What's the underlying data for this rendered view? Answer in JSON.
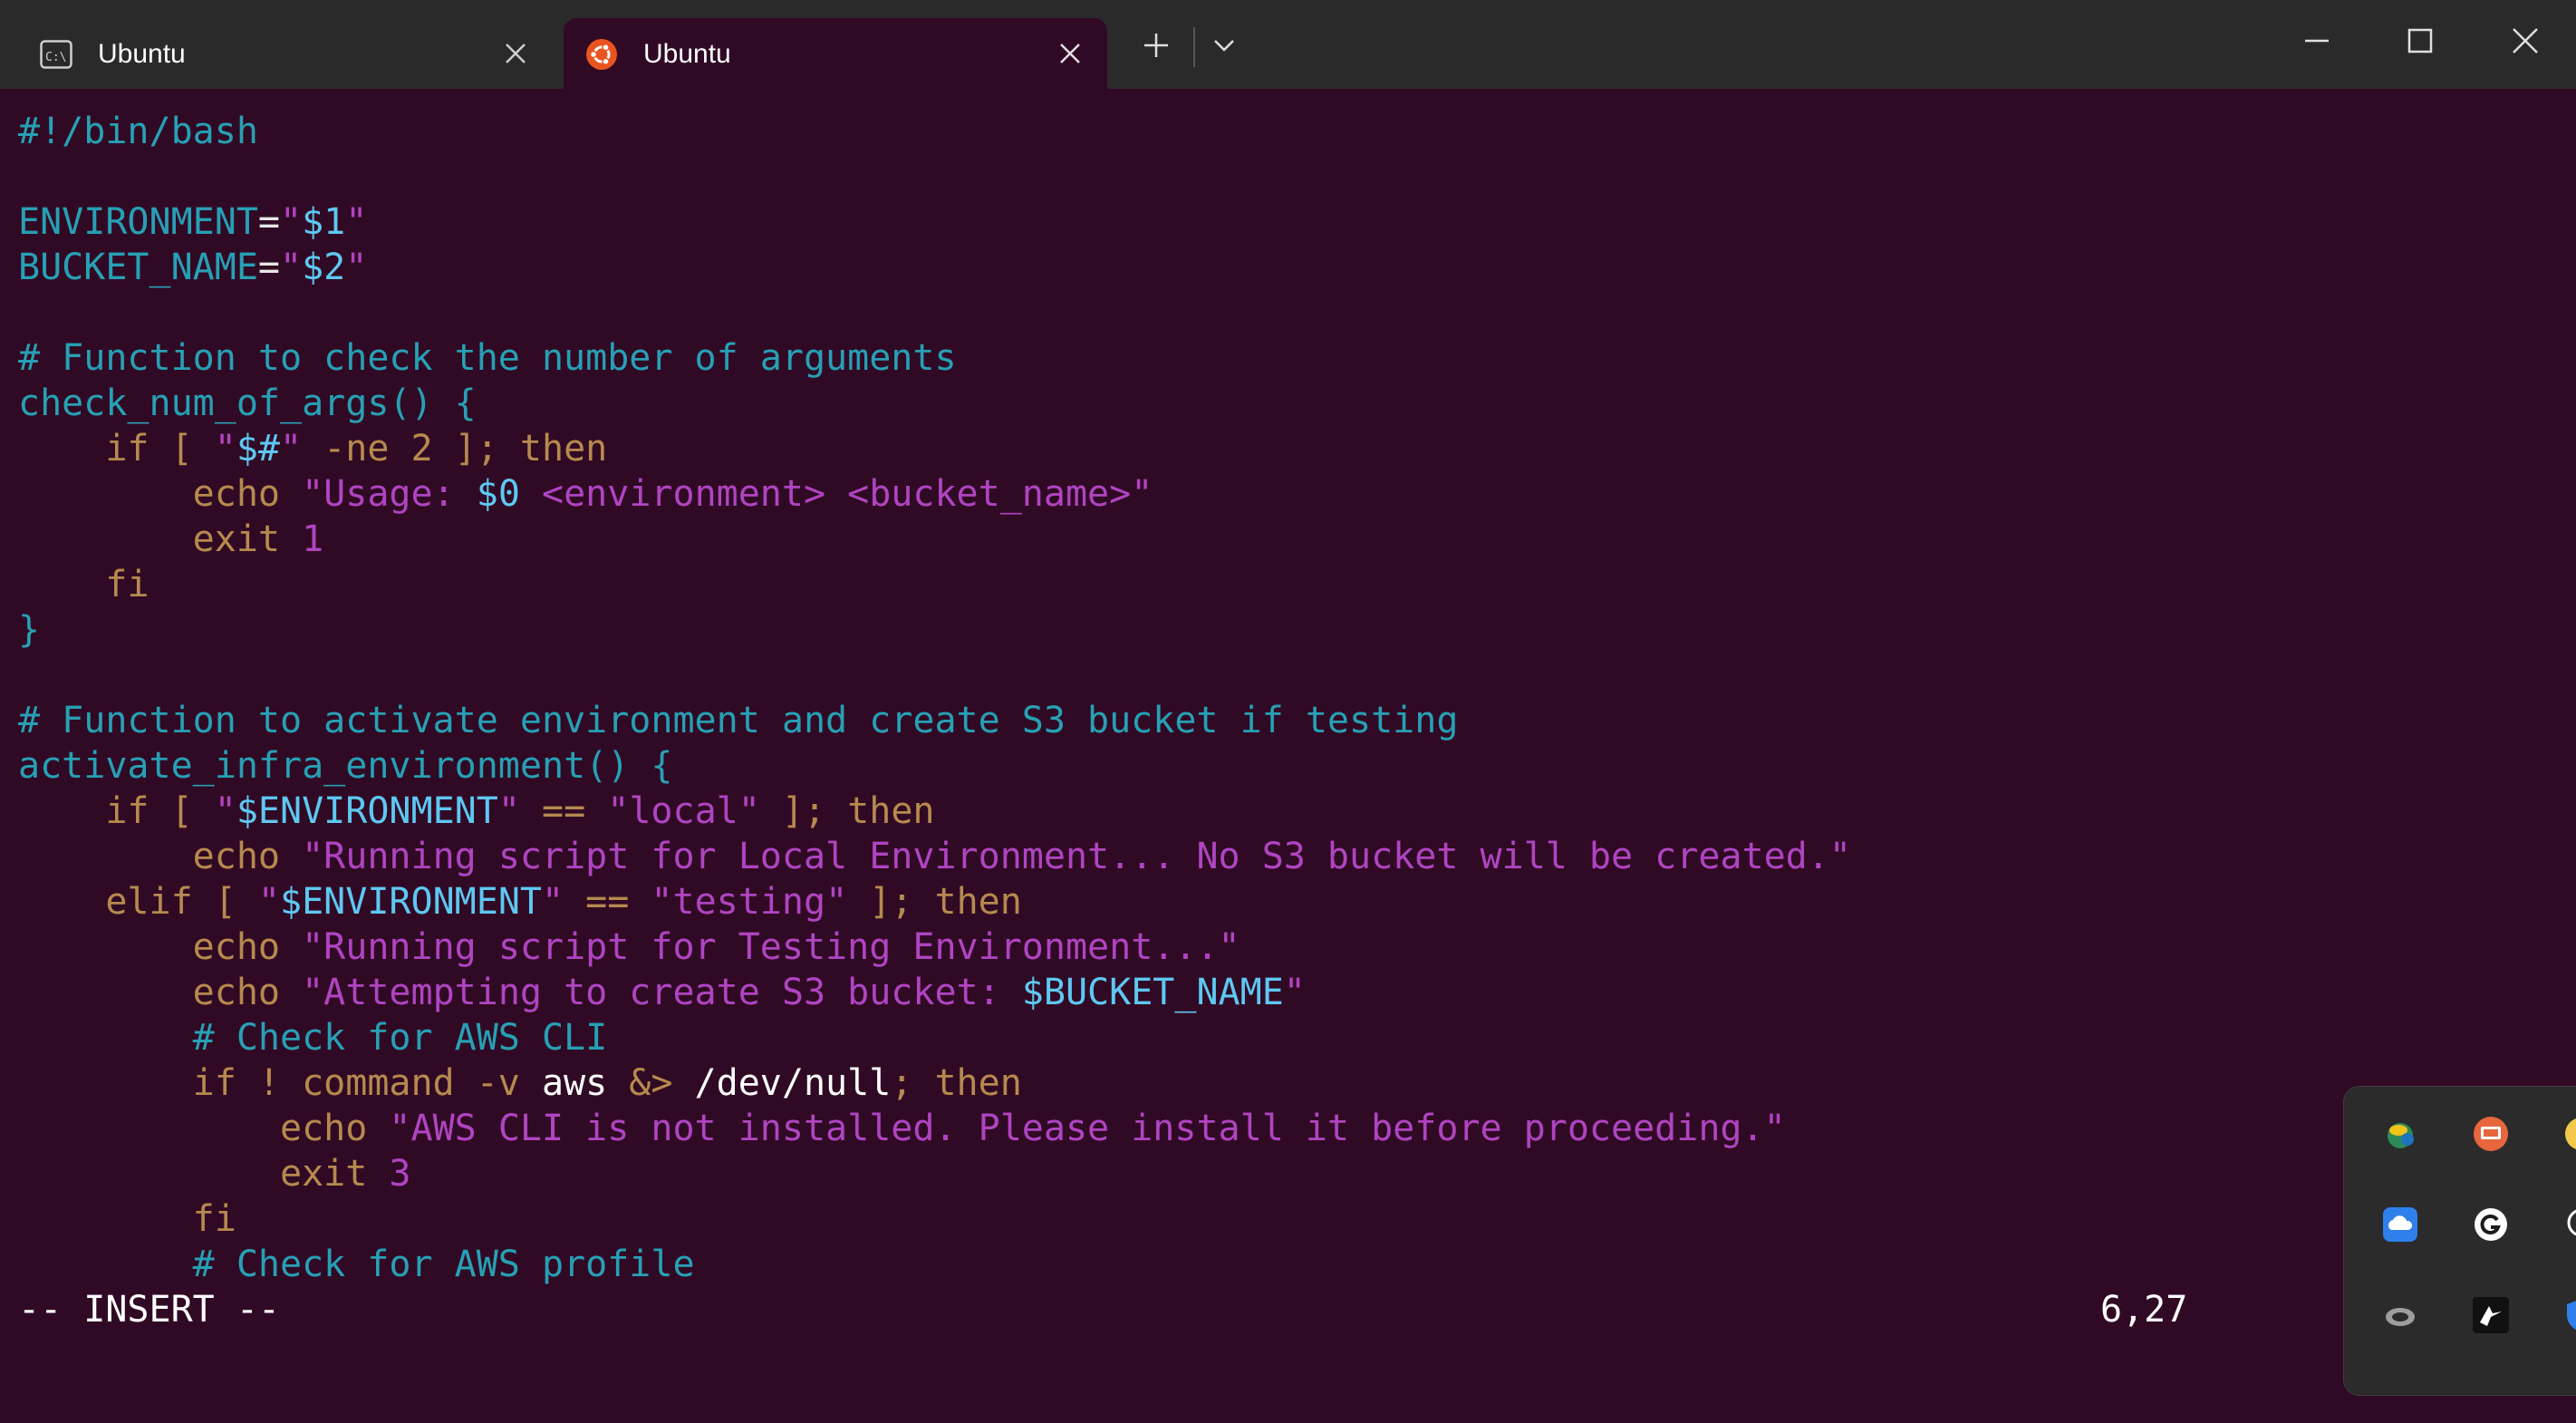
{
  "tabs": [
    {
      "label": "Ubuntu",
      "icon": "cmd-icon",
      "active": false
    },
    {
      "label": "Ubuntu",
      "icon": "ubuntu-icon",
      "active": true
    }
  ],
  "toolbar": {
    "new_tab_icon": "plus-icon",
    "dropdown_icon": "chevron-down-icon"
  },
  "window_controls": [
    "minimize-icon",
    "maximize-icon",
    "close-icon"
  ],
  "code_lines": [
    [
      {
        "t": "#!/bin/bash",
        "c": "cm"
      }
    ],
    [],
    [
      {
        "t": "ENVIRONMENT",
        "c": "id"
      },
      {
        "t": "=",
        "c": "pl"
      },
      {
        "t": "\"",
        "c": "st"
      },
      {
        "t": "$1",
        "c": "va"
      },
      {
        "t": "\"",
        "c": "st"
      }
    ],
    [
      {
        "t": "BUCKET_NAME",
        "c": "id"
      },
      {
        "t": "=",
        "c": "pl"
      },
      {
        "t": "\"",
        "c": "st"
      },
      {
        "t": "$2",
        "c": "va"
      },
      {
        "t": "\"",
        "c": "st"
      }
    ],
    [],
    [
      {
        "t": "# Function to check the number of arguments",
        "c": "cm"
      }
    ],
    [
      {
        "t": "check_num_of_args() {",
        "c": "id"
      }
    ],
    [
      {
        "t": "    if [ ",
        "c": "kw"
      },
      {
        "t": "\"",
        "c": "st"
      },
      {
        "t": "$#",
        "c": "va"
      },
      {
        "t": "\"",
        "c": "st"
      },
      {
        "t": " -ne 2 ]; then",
        "c": "kw"
      }
    ],
    [
      {
        "t": "        echo ",
        "c": "kw"
      },
      {
        "t": "\"Usage: ",
        "c": "st"
      },
      {
        "t": "$0",
        "c": "va"
      },
      {
        "t": " <environment> <bucket_name>\"",
        "c": "st"
      }
    ],
    [
      {
        "t": "        exit ",
        "c": "kw"
      },
      {
        "t": "1",
        "c": "st"
      }
    ],
    [
      {
        "t": "    fi",
        "c": "kw"
      }
    ],
    [
      {
        "t": "}",
        "c": "id"
      }
    ],
    [],
    [
      {
        "t": "# Function to activate environment and create S3 bucket if testing",
        "c": "cm"
      }
    ],
    [
      {
        "t": "activate_infra_environment() {",
        "c": "id"
      }
    ],
    [
      {
        "t": "    if [ ",
        "c": "kw"
      },
      {
        "t": "\"",
        "c": "st"
      },
      {
        "t": "$ENVIRONMENT",
        "c": "va"
      },
      {
        "t": "\"",
        "c": "st"
      },
      {
        "t": " == ",
        "c": "kw"
      },
      {
        "t": "\"local\"",
        "c": "st"
      },
      {
        "t": " ]; then",
        "c": "kw"
      }
    ],
    [
      {
        "t": "        echo ",
        "c": "kw"
      },
      {
        "t": "\"Running script for Local Environment... No S3 bucket will be created.\"",
        "c": "st"
      }
    ],
    [
      {
        "t": "    elif [ ",
        "c": "kw"
      },
      {
        "t": "\"",
        "c": "st"
      },
      {
        "t": "$ENVIRONMENT",
        "c": "va"
      },
      {
        "t": "\"",
        "c": "st"
      },
      {
        "t": " == ",
        "c": "kw"
      },
      {
        "t": "\"testing\"",
        "c": "st"
      },
      {
        "t": " ]; then",
        "c": "kw"
      }
    ],
    [
      {
        "t": "        echo ",
        "c": "kw"
      },
      {
        "t": "\"Running script for Testing Environment...\"",
        "c": "st"
      }
    ],
    [
      {
        "t": "        echo ",
        "c": "kw"
      },
      {
        "t": "\"Attempting to create S3 bucket: ",
        "c": "st"
      },
      {
        "t": "$BUCKET_NAME",
        "c": "va"
      },
      {
        "t": "\"",
        "c": "st"
      }
    ],
    [
      {
        "t": "        # Check for AWS CLI",
        "c": "cm"
      }
    ],
    [
      {
        "t": "        if ! command -v ",
        "c": "kw"
      },
      {
        "t": "aws",
        "c": "wh"
      },
      {
        "t": " &> ",
        "c": "kw"
      },
      {
        "t": "/dev/null",
        "c": "wh"
      },
      {
        "t": "; then",
        "c": "kw"
      }
    ],
    [
      {
        "t": "            echo ",
        "c": "kw"
      },
      {
        "t": "\"AWS CLI is not installed. Please install it before proceeding.\"",
        "c": "st"
      }
    ],
    [
      {
        "t": "            exit ",
        "c": "kw"
      },
      {
        "t": "3",
        "c": "st"
      }
    ],
    [
      {
        "t": "        fi",
        "c": "kw"
      }
    ],
    [
      {
        "t": "        # Check for AWS profile",
        "c": "cm"
      }
    ]
  ],
  "status": {
    "mode": "-- INSERT --",
    "position": "6,27"
  },
  "tray_icons": [
    "network-globe-icon",
    "monitor-app-icon",
    "emoji-app-icon",
    "cloud-sync-icon",
    "grammarly-icon",
    "chat-icon",
    "creative-cloud-icon",
    "cursor-app-icon",
    "shield-icon"
  ],
  "colors": {
    "background": "#300a24",
    "titlebar": "#2a2a2a",
    "comment": "#27a0b5",
    "keyword": "#b68a4e",
    "string": "#b044c2",
    "variable": "#5ec8f2"
  }
}
